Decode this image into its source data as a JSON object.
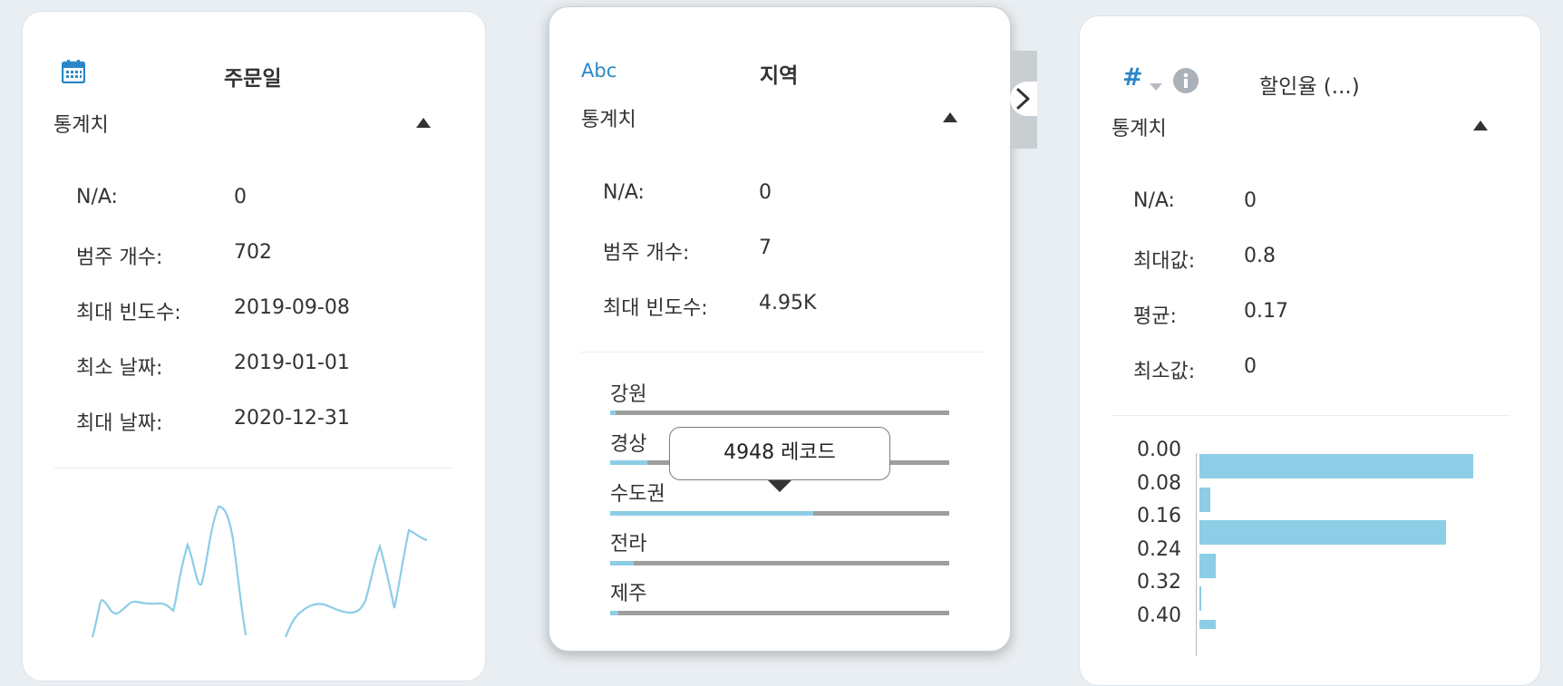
{
  "cards": {
    "order_date": {
      "type_icon": "calendar-icon",
      "title": "주문일",
      "section_label": "통계치",
      "stats": [
        {
          "label": "N/A:",
          "value": "0"
        },
        {
          "label": "범주 개수:",
          "value": "702"
        },
        {
          "label": "최대 빈도수:",
          "value": "2019-09-08"
        },
        {
          "label": "최소 날짜:",
          "value": "2019-01-01"
        },
        {
          "label": "최대 날짜:",
          "value": "2020-12-31"
        }
      ],
      "sparkline_color": "#8dcde6"
    },
    "region": {
      "type_label": "Abc",
      "title": "지역",
      "section_label": "통계치",
      "stats": [
        {
          "label": "N/A:",
          "value": "0"
        },
        {
          "label": "범주 개수:",
          "value": "7"
        },
        {
          "label": "최대 빈도수:",
          "value": "4.95K"
        }
      ],
      "categories": [
        {
          "label": "강원",
          "fraction": 0.015
        },
        {
          "label": "경상",
          "fraction": 0.11
        },
        {
          "label": "수도권",
          "fraction": 0.6
        },
        {
          "label": "전라",
          "fraction": 0.07
        },
        {
          "label": "제주",
          "fraction": 0.025
        }
      ],
      "tooltip": "4948 레코드",
      "collapse_icon": "chevron-right-icon"
    },
    "discount": {
      "type_label": "#",
      "type_icons": [
        "chevron-down-icon",
        "info-icon"
      ],
      "title": "할인율 (...)",
      "section_label": "통계치",
      "stats": [
        {
          "label": "N/A:",
          "value": "0"
        },
        {
          "label": "최대값:",
          "value": "0.8"
        },
        {
          "label": "평균:",
          "value": "0.17"
        },
        {
          "label": "최소값:",
          "value": "0"
        }
      ]
    }
  },
  "chart_data": {
    "type": "bar",
    "orientation": "horizontal",
    "categories": [
      "0.00",
      "0.08",
      "0.16",
      "0.24",
      "0.32",
      "0.40"
    ],
    "values": [
      1.0,
      0.04,
      0.9,
      0.06,
      0.005,
      0.06
    ],
    "bar_color": "#8dcde6"
  }
}
